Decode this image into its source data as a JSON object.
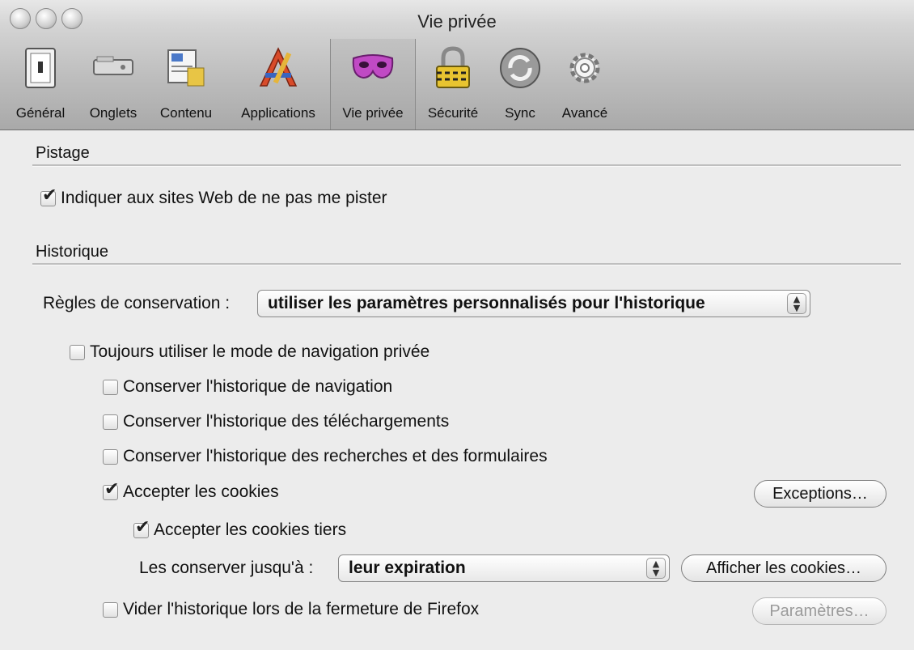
{
  "window": {
    "title": "Vie privée"
  },
  "toolbar": {
    "items": [
      {
        "label": "Général",
        "icon": "general-icon"
      },
      {
        "label": "Onglets",
        "icon": "tabs-icon"
      },
      {
        "label": "Contenu",
        "icon": "content-icon"
      },
      {
        "label": "Applications",
        "icon": "applications-icon"
      },
      {
        "label": "Vie privée",
        "icon": "privacy-mask-icon",
        "selected": true
      },
      {
        "label": "Sécurité",
        "icon": "padlock-icon"
      },
      {
        "label": "Sync",
        "icon": "sync-icon"
      },
      {
        "label": "Avancé",
        "icon": "gear-icon"
      }
    ]
  },
  "tracking": {
    "title": "Pistage",
    "dnt_label": "Indiquer aux sites Web de ne pas me pister",
    "dnt_checked": true
  },
  "history": {
    "title": "Historique",
    "rules_label": "Règles de conservation :",
    "rules_value": "utiliser les paramètres personnalisés pour l'historique",
    "private_mode": {
      "label": "Toujours utiliser le mode de navigation privée",
      "checked": false
    },
    "keep_browsing": {
      "label": "Conserver l'historique de navigation",
      "checked": false
    },
    "keep_downloads": {
      "label": "Conserver l'historique des téléchargements",
      "checked": false
    },
    "keep_forms": {
      "label": "Conserver l'historique des recherches et des formulaires",
      "checked": false
    },
    "accept_cookies": {
      "label": "Accepter les cookies",
      "checked": true
    },
    "exceptions_button": "Exceptions…",
    "third_party": {
      "label": "Accepter les cookies tiers",
      "checked": true
    },
    "keep_until_label": "Les conserver jusqu'à :",
    "keep_until_value": "leur expiration",
    "show_cookies_button": "Afficher les cookies…",
    "clear_on_close": {
      "label": "Vider l'historique lors de la fermeture de Firefox",
      "checked": false
    },
    "settings_button": "Paramètres…"
  }
}
